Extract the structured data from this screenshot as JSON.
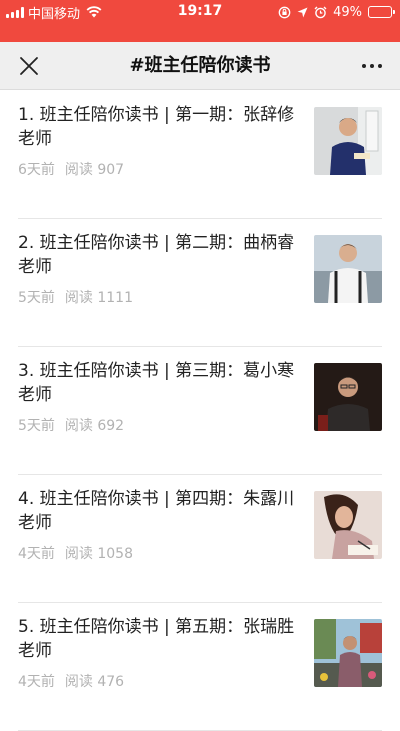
{
  "status_bar": {
    "carrier": "中国移动",
    "time": "19:17",
    "battery": "49%",
    "battery_level": 0.49
  },
  "nav": {
    "title": "#班主任陪你读书",
    "close_icon": "close-icon",
    "more_icon": "more-icon"
  },
  "articles": [
    {
      "title": "1. 班主任陪你读书 | 第一期：张辞修老师",
      "date": "6天前",
      "reads": "阅读 907"
    },
    {
      "title": "2. 班主任陪你读书 | 第二期：曲柄睿老师",
      "date": "5天前",
      "reads": "阅读 1111"
    },
    {
      "title": "3. 班主任陪你读书 | 第三期：葛小寒老师",
      "date": "5天前",
      "reads": "阅读 692"
    },
    {
      "title": "4. 班主任陪你读书 | 第四期：朱露川老师",
      "date": "4天前",
      "reads": "阅读 1058"
    },
    {
      "title": "5. 班主任陪你读书 | 第五期：张瑞胜老师",
      "date": "4天前",
      "reads": "阅读 476"
    }
  ]
}
